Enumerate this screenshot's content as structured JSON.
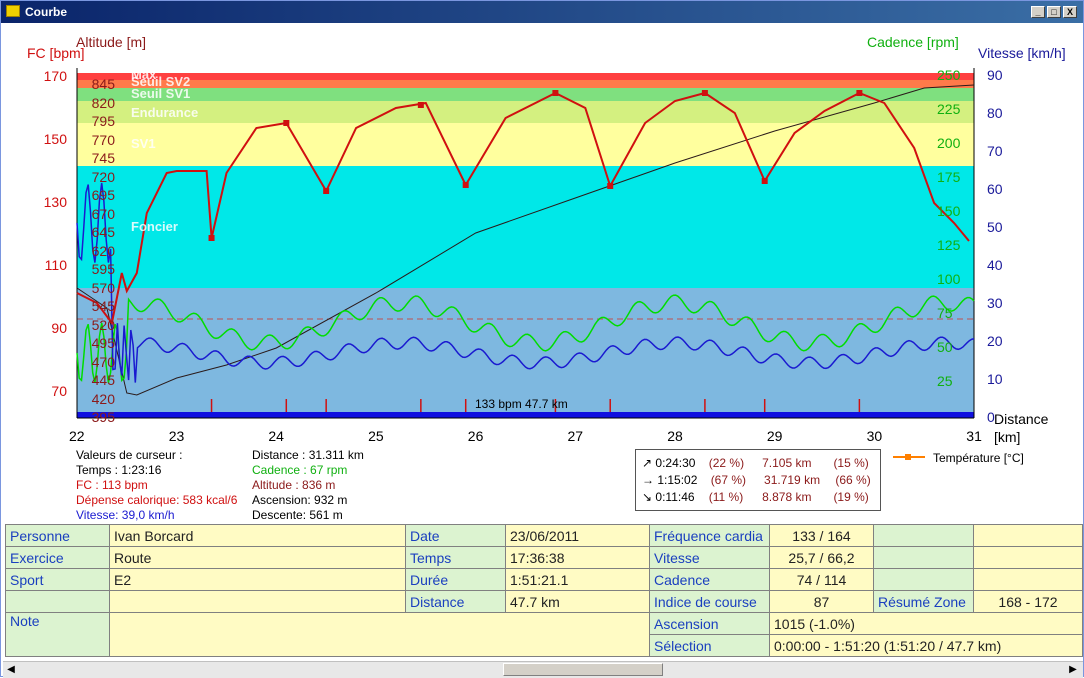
{
  "window": {
    "title": "Courbe",
    "minimize": "_",
    "maximize": "□",
    "close": "X"
  },
  "axes": {
    "fc_label": "FC [bpm]",
    "altitude_label": "Altitude  [m]",
    "cadence_label": "Cadence [rpm]",
    "vitesse_label": "Vitesse [km/h]",
    "distance_label_1": "Distance",
    "distance_label_2": "[km]",
    "fc_ticks": [
      "170",
      "150",
      "130",
      "110",
      "90",
      "70"
    ],
    "alt_ticks": [
      "845",
      "820",
      "795",
      "770",
      "745",
      "720",
      "695",
      "670",
      "645",
      "620",
      "595",
      "570",
      "545",
      "520",
      "495",
      "470",
      "445",
      "420",
      "395"
    ],
    "cad_ticks": [
      "250",
      "225",
      "200",
      "175",
      "150",
      "125",
      "100",
      "75",
      "50",
      "25"
    ],
    "vit_ticks": [
      "90",
      "80",
      "70",
      "60",
      "50",
      "40",
      "30",
      "20",
      "10",
      "0"
    ],
    "x_ticks": [
      "22",
      "23",
      "24",
      "25",
      "26",
      "27",
      "28",
      "29",
      "30",
      "31"
    ]
  },
  "zones": [
    {
      "name": "Max",
      "color": "#ff4040"
    },
    {
      "name": "Seuil SV2",
      "color": "#ff7a4a"
    },
    {
      "name": "Seuil SV1",
      "color": "#7fe07f"
    },
    {
      "name": "Endurance",
      "color": "#d4f080"
    },
    {
      "name": "SV1",
      "color": "#ffff9e"
    },
    {
      "name": "Foncier",
      "color": "#00e8e8"
    }
  ],
  "chart_marker_text": "133 bpm 47.7 km",
  "legend": {
    "temperature": "Température [°C]"
  },
  "cursor_values": {
    "header": "Valeurs de curseur :",
    "temps": "Temps : 1:23:16",
    "fc": "FC : 113 bpm",
    "depense": "Dépense calorique: 583 kcal/6",
    "vitesse": "Vitesse: 39,0 km/h",
    "distance": "Distance : 31.311 km",
    "cadence": "Cadence : 67 rpm",
    "altitude": "Altitude : 836 m",
    "ascension": "Ascension: 932 m",
    "descente": "Descente: 561 m"
  },
  "slope_summary": [
    {
      "arrow": "↗",
      "time": "0:24:30",
      "pct": "(22 %)",
      "dist": "7.105 km",
      "dpct": "(15 %)"
    },
    {
      "arrow": "→",
      "time": "1:15:02",
      "pct": "(67 %)",
      "dist": "31.719 km",
      "dpct": "(66 %)"
    },
    {
      "arrow": "↘",
      "time": "0:11:46",
      "pct": "(11 %)",
      "dist": "8.878 km",
      "dpct": "(19 %)"
    }
  ],
  "summary": {
    "personne_label": "Personne",
    "personne": "Ivan Borcard",
    "exercice_label": "Exercice",
    "exercice": "Route",
    "sport_label": "Sport",
    "sport": "E2",
    "note_label": "Note",
    "date_label": "Date",
    "date": "23/06/2011",
    "temps_label": "Temps",
    "temps": "17:36:38",
    "duree_label": "Durée",
    "duree": "1:51:21.1",
    "distance_label": "Distance",
    "distance": "47.7 km",
    "fc_label": "Fréquence cardia",
    "fc": "133 / 164",
    "vitesse_label": "Vitesse",
    "vitesse": "25,7 / 66,2",
    "cadence_label": "Cadence",
    "cadence": "74 / 114",
    "indice_label": "Indice de course",
    "indice": "87",
    "zone_label": "Résumé Zone",
    "zone": "168 - 172",
    "ascension_label": "Ascension",
    "ascension": "1015 (-1.0%)",
    "selection_label": "Sélection",
    "selection": "0:00:00 - 1:51:20 (1:51:20 / 47.7 km)"
  }
}
